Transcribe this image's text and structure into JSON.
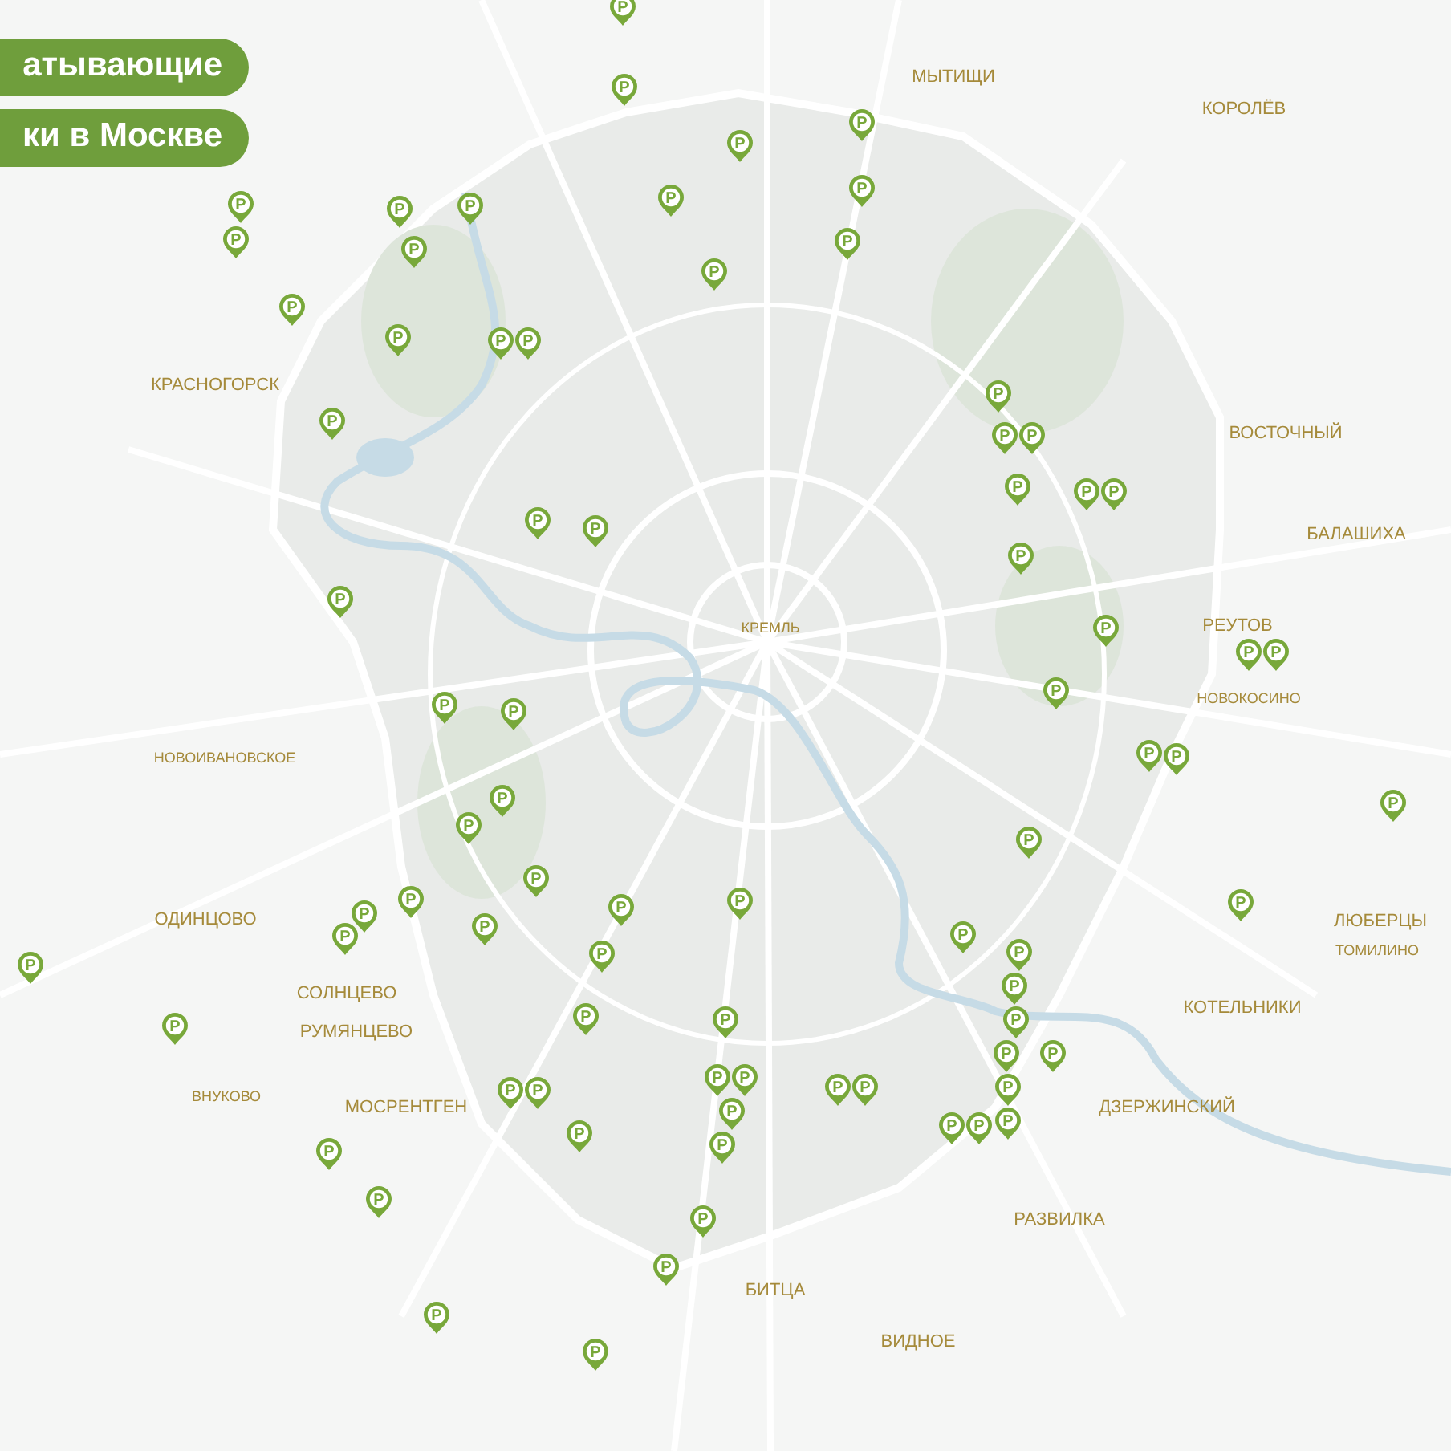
{
  "title_lines": [
    "атывающие",
    "ки в Москве"
  ],
  "places": [
    "МЫТИЩИ",
    "КОРОЛЁВ",
    "КРАСНОГОРСК",
    "ВОСТОЧНЫЙ",
    "БАЛАШИХА",
    "РЕУТОВ",
    "КРЕМЛЬ",
    "НОВОКОСИНО",
    "НОВОИВАНОВСКОЕ",
    "ОДИНЦОВО",
    "ЛЮБЕРЦЫ",
    "ТОМИЛИНО",
    "СОЛНЦЕВО",
    "КОТЕЛЬНИКИ",
    "РУМЯНЦЕВО",
    "ВНУКОВО",
    "МОСРЕНТГЕН",
    "ДЗЕРЖИНСКИЙ",
    "РАЗВИЛКА",
    "БИТЦА",
    "ВИДНОЕ"
  ],
  "pins": [
    {
      "label": "P"
    },
    {
      "label": "P"
    },
    {
      "label": "P"
    },
    {
      "label": "P"
    },
    {
      "label": "P"
    },
    {
      "label": "P"
    },
    {
      "label": "P"
    },
    {
      "label": "P"
    },
    {
      "label": "P"
    },
    {
      "label": "P"
    },
    {
      "label": "P"
    },
    {
      "label": "P"
    },
    {
      "label": "P"
    },
    {
      "label": "P"
    },
    {
      "label": "P"
    },
    {
      "label": "P"
    },
    {
      "label": "P"
    },
    {
      "label": "P"
    },
    {
      "label": "P"
    },
    {
      "label": "P"
    },
    {
      "label": "P"
    },
    {
      "label": "P"
    },
    {
      "label": "P"
    },
    {
      "label": "P"
    },
    {
      "label": "P"
    },
    {
      "label": "P"
    },
    {
      "label": "P"
    },
    {
      "label": "P"
    },
    {
      "label": "P"
    },
    {
      "label": "P"
    },
    {
      "label": "P"
    },
    {
      "label": "P"
    },
    {
      "label": "P"
    },
    {
      "label": "P"
    },
    {
      "label": "P"
    },
    {
      "label": "P"
    },
    {
      "label": "P"
    },
    {
      "label": "P"
    },
    {
      "label": "P"
    },
    {
      "label": "P"
    },
    {
      "label": "P"
    },
    {
      "label": "P"
    },
    {
      "label": "P"
    },
    {
      "label": "P"
    },
    {
      "label": "P"
    },
    {
      "label": "P"
    },
    {
      "label": "P"
    },
    {
      "label": "P"
    },
    {
      "label": "P"
    },
    {
      "label": "P"
    },
    {
      "label": "P"
    },
    {
      "label": "P"
    },
    {
      "label": "P"
    },
    {
      "label": "P"
    },
    {
      "label": "P"
    },
    {
      "label": "P"
    },
    {
      "label": "P"
    },
    {
      "label": "P"
    },
    {
      "label": "P"
    },
    {
      "label": "P"
    },
    {
      "label": "P"
    },
    {
      "label": "P"
    },
    {
      "label": "P"
    },
    {
      "label": "P"
    },
    {
      "label": "P"
    },
    {
      "label": "P"
    },
    {
      "label": "P"
    },
    {
      "label": "P"
    },
    {
      "label": "P"
    },
    {
      "label": "P"
    },
    {
      "label": "P"
    },
    {
      "label": "P"
    },
    {
      "label": "P"
    },
    {
      "label": "P"
    },
    {
      "label": "P"
    },
    {
      "label": "P"
    },
    {
      "label": "P"
    },
    {
      "label": "P"
    }
  ]
}
